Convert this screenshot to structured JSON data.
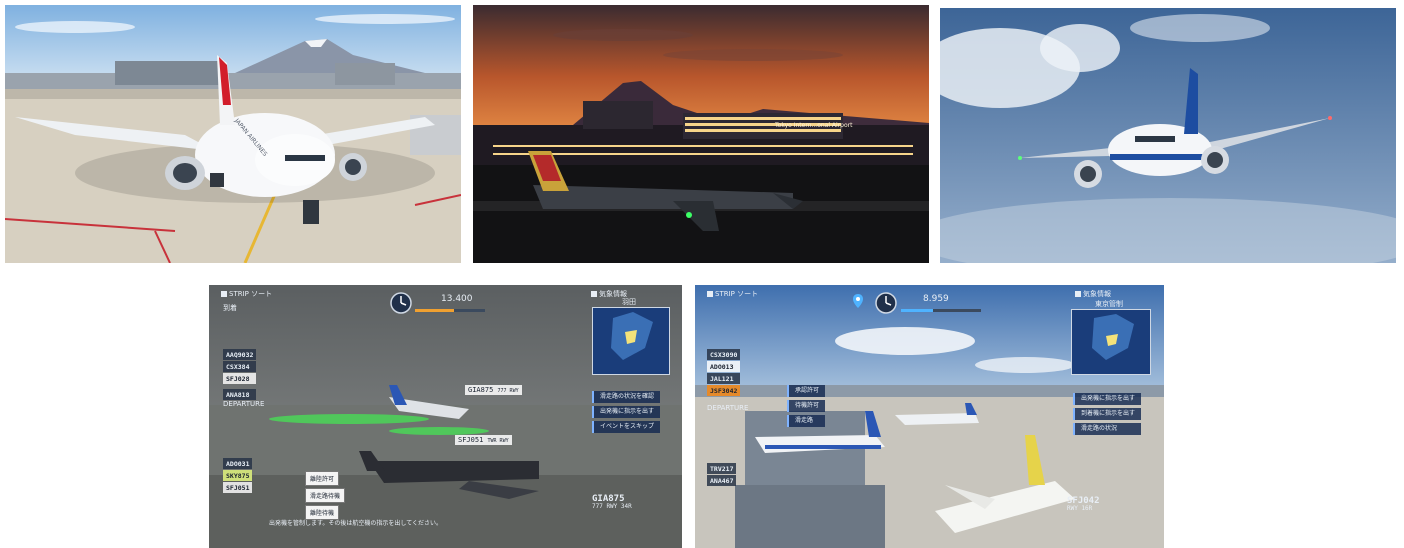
{
  "screenshots": {
    "jal": {
      "livery_text": "JAPAN AIRLINES",
      "colors": {
        "sky": "#9cc3e6",
        "tarmac": "#d9d3c5",
        "tail": "#d21e2b"
      }
    },
    "sunset": {
      "terminal_sign": "Tokyo Intern...onal Airport",
      "colors": {
        "sky_top": "#3a2a2e",
        "sky_glow": "#e07a3c",
        "terminal_lights": "#f6d48a"
      }
    },
    "ana_flight": {
      "colors": {
        "sky": "#6f8fb8",
        "cloud": "#e9eef4",
        "tail": "#1d4da1"
      }
    },
    "hud_fog": {
      "mode_label": "STRIP ソート",
      "header_right": "気象情報",
      "map_title": "羽田",
      "clock_value": "13.400",
      "section_arrival": "到着",
      "section_departure": "DEPARTURE",
      "arrival_strips": [
        {
          "cs": "AAQ9032",
          "kind": "arr"
        },
        {
          "cs": "CSX384",
          "kind": "arr"
        },
        {
          "cs": "SFJ028",
          "kind": "dep"
        },
        {
          "cs": "ANA818",
          "kind": "arr"
        }
      ],
      "departure_strips": [
        {
          "cs": "ADO031",
          "kind": "arr"
        },
        {
          "cs": "SKY875",
          "kind": "sel"
        },
        {
          "cs": "SFJ051",
          "kind": "dep"
        }
      ],
      "tags": [
        {
          "cs": "GIA875",
          "info": "777 RWY"
        },
        {
          "cs": "SFJ051",
          "info": "TWR RWY"
        }
      ],
      "command_buttons": [
        "離陸許可",
        "滑走路待機",
        "離陸待機"
      ],
      "menu_items": [
        "滑走路の状況を確認",
        "出発機に指示を出す",
        "イベントをスキップ"
      ],
      "bottom_message": "出発機を管制します。その後は航空機の指示を出してください。",
      "info_panel": {
        "cs": "GIA875",
        "line1": "777 RWY 34R"
      }
    },
    "hud_clear": {
      "mode_label": "STRIP ソート",
      "header_right": "気象情報",
      "map_title": "東京管制",
      "clock_value": "8.959",
      "section_departure": "DEPARTURE",
      "arrival_strips": [
        {
          "cs": "CSX3090",
          "kind": "arr"
        },
        {
          "cs": "ADO013",
          "kind": "dep"
        },
        {
          "cs": "JAL121",
          "kind": "arr"
        },
        {
          "cs": "JSF3042",
          "kind": "alert"
        }
      ],
      "departure_strips": [
        {
          "cs": "TRV217",
          "kind": "arr"
        },
        {
          "cs": "ANA467",
          "kind": "arr"
        }
      ],
      "menu_items": [
        "出発機に指示を出す",
        "到着機に指示を出す",
        "滑走路の状況"
      ],
      "center_buttons": [
        "承認許可",
        "待機許可",
        "滑走路"
      ],
      "info_panel": {
        "cs": "SFJ042",
        "line1": "RWY 16R"
      }
    }
  }
}
